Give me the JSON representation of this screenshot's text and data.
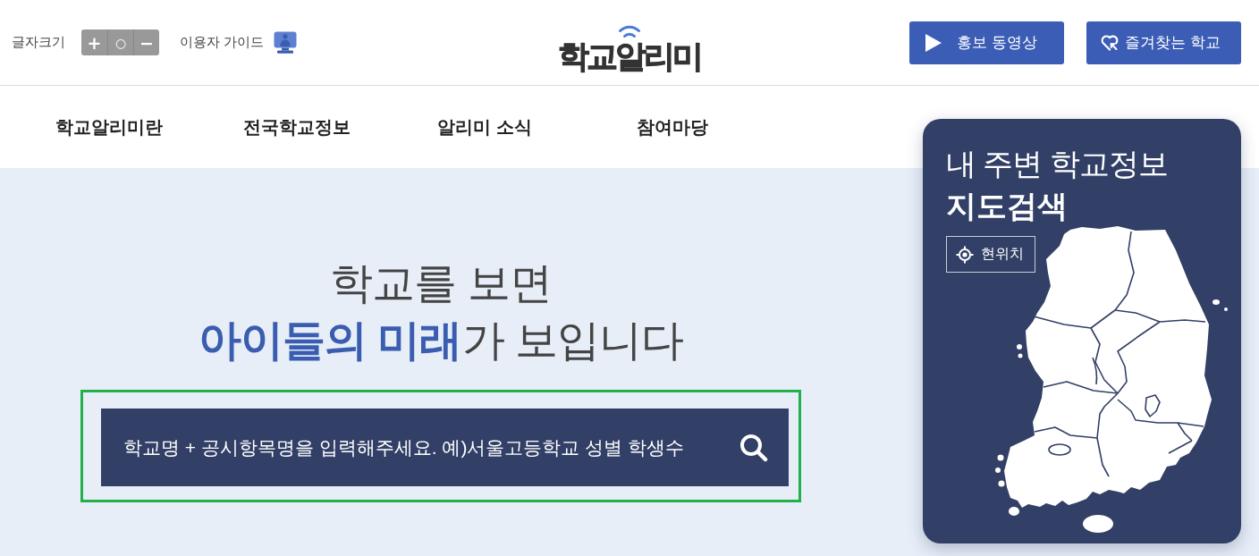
{
  "header": {
    "font_size": {
      "label": "글자크기",
      "buttons": [
        "+",
        "○",
        "−"
      ]
    },
    "guide_link": "이용자 가이드",
    "logo": "학교알리미",
    "buttons": [
      {
        "kind": "video",
        "label": "홍보 동영상"
      },
      {
        "kind": "favorites",
        "label": "즐겨찾는 학교"
      }
    ]
  },
  "nav": {
    "items": [
      "학교알리미란",
      "전국학교정보",
      "알리미 소식",
      "참여마당"
    ]
  },
  "hero": {
    "headline": [
      "학교를 보면",
      "**아이들의 미래**가 보입니다"
    ],
    "search": {
      "placeholder": "학교명 + 공시항목명을 입력해주세요. 예)서울고등학교 성별 학생수",
      "highlighted": true
    }
  },
  "map_card": {
    "title": "내 주변 학교정보",
    "subtitle": "지도검색",
    "location_button": "현위치"
  }
}
